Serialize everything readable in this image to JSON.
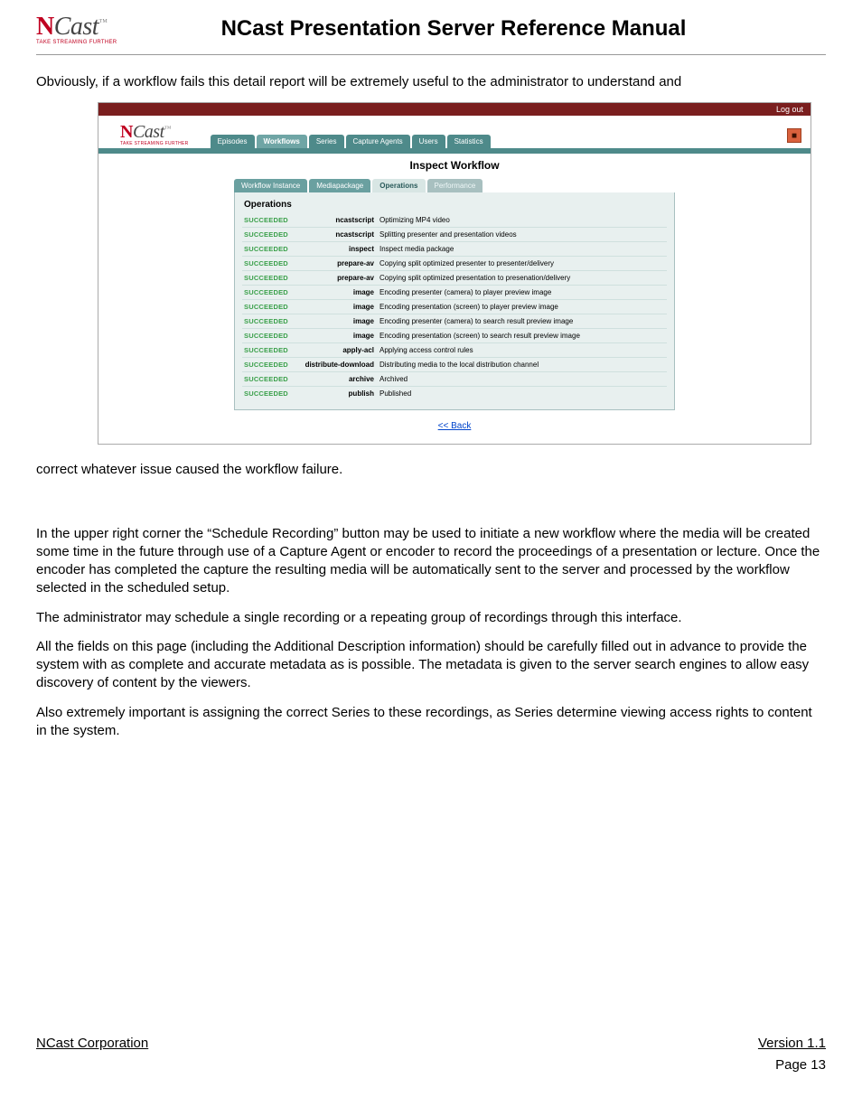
{
  "header": {
    "logo_n": "N",
    "logo_cast": "Cast",
    "logo_tag": "TAKE STREAMING FURTHER",
    "title": "NCast Presentation Server Reference Manual"
  },
  "para1": "Obviously, if a workflow fails this detail report will be extremely useful to the administrator to understand and",
  "screenshot": {
    "logout": "Log out",
    "main_tabs": [
      "Episodes",
      "Workflows",
      "Series",
      "Capture Agents",
      "Users",
      "Statistics"
    ],
    "main_tabs_selected_index": 1,
    "title": "Inspect Workflow",
    "sub_tabs": [
      "Workflow Instance",
      "Mediapackage",
      "Operations",
      "Performance"
    ],
    "sub_tabs_selected_index": 2,
    "panel_header": "Operations",
    "ops": [
      {
        "status": "SUCCEEDED",
        "label": "ncastscript",
        "desc": "Optimizing MP4 video"
      },
      {
        "status": "SUCCEEDED",
        "label": "ncastscript",
        "desc": "Splitting presenter and presentation videos"
      },
      {
        "status": "SUCCEEDED",
        "label": "inspect",
        "desc": "Inspect media package"
      },
      {
        "status": "SUCCEEDED",
        "label": "prepare-av",
        "desc": "Copying split optimized presenter to presenter/delivery"
      },
      {
        "status": "SUCCEEDED",
        "label": "prepare-av",
        "desc": "Copying split optimized presentation to presenation/delivery"
      },
      {
        "status": "SUCCEEDED",
        "label": "image",
        "desc": "Encoding presenter (camera) to player preview image"
      },
      {
        "status": "SUCCEEDED",
        "label": "image",
        "desc": "Encoding presentation (screen) to player preview image"
      },
      {
        "status": "SUCCEEDED",
        "label": "image",
        "desc": "Encoding presenter (camera) to search result preview image"
      },
      {
        "status": "SUCCEEDED",
        "label": "image",
        "desc": "Encoding presentation (screen) to search result preview image"
      },
      {
        "status": "SUCCEEDED",
        "label": "apply-acl",
        "desc": "Applying access control rules"
      },
      {
        "status": "SUCCEEDED",
        "label": "distribute-download",
        "desc": "Distributing media to the local distribution channel"
      },
      {
        "status": "SUCCEEDED",
        "label": "archive",
        "desc": "Archived"
      },
      {
        "status": "SUCCEEDED",
        "label": "publish",
        "desc": "Published"
      }
    ],
    "back": "<< Back"
  },
  "para2": "correct whatever issue caused the workflow failure.",
  "para3": "In the upper right corner the “Schedule Recording” button may be used to initiate a new workflow where the media will be created some time in the future through use of a Capture Agent or encoder to record the proceedings of a presentation or lecture. Once the encoder has completed the capture the resulting media will be automatically sent to the server and processed by the workflow selected in the scheduled setup.",
  "para4": "The administrator may schedule a single recording or a repeating group of recordings through this interface.",
  "para5": "All the fields on this page (including the Additional Description information) should be carefully filled out in advance to provide the system with as complete and accurate metadata as is possible. The metadata is given to the server search engines to allow easy discovery of content by the viewers.",
  "para6": "Also extremely important is assigning the correct Series to these recordings, as Series determine viewing access rights to content in the system.",
  "footer": {
    "left": "NCast Corporation",
    "right": "Version 1.1",
    "page": "Page 13"
  }
}
